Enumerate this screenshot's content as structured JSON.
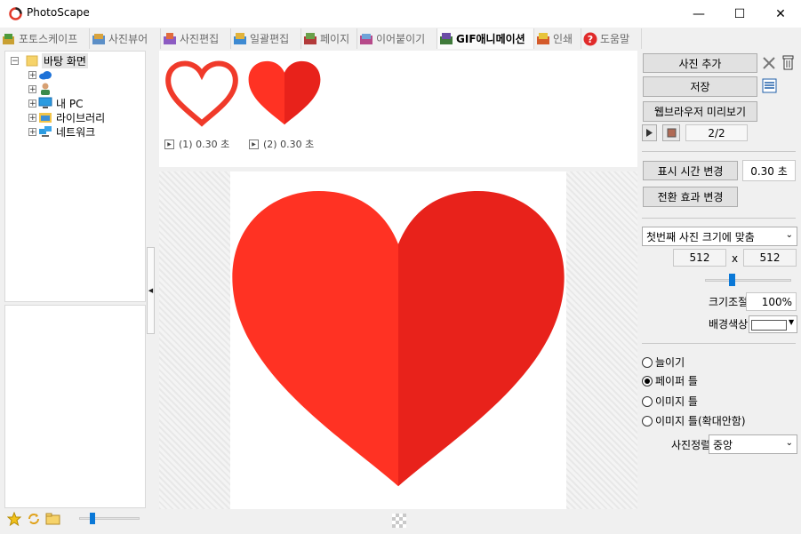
{
  "window": {
    "title": "PhotoScape",
    "minimize": "—",
    "maximize": "☐",
    "close": "✕"
  },
  "tabs": [
    {
      "label": "포토스케이프"
    },
    {
      "label": "사진뷰어"
    },
    {
      "label": "사진편집"
    },
    {
      "label": "일괄편집"
    },
    {
      "label": "페이지"
    },
    {
      "label": "이어붙이기"
    },
    {
      "label": "GIF애니메이션"
    },
    {
      "label": "인쇄"
    },
    {
      "label": "도움말"
    }
  ],
  "tree": {
    "root": "바탕 화면",
    "items": [
      {
        "label": ""
      },
      {
        "label": ""
      },
      {
        "label": "내 PC"
      },
      {
        "label": "라이브러리"
      },
      {
        "label": "네트워크"
      }
    ]
  },
  "frames": [
    {
      "caption": "(1) 0.30 초"
    },
    {
      "caption": "(2) 0.30 초"
    }
  ],
  "colors": {
    "heart_left": "#ff3223",
    "heart_right": "#e8221b",
    "outline": "#f03a2a"
  },
  "controls": {
    "add_photo": "사진 추가",
    "save": "저장",
    "preview_browser": "웹브라우저 미리보기",
    "frame_counter": "2/2",
    "display_time_button": "표시 시간 변경",
    "display_time_value": "0.30 초",
    "transition_button": "전환 효과 변경",
    "size_mode": "첫번째 사진 크기에 맞춤",
    "width": "512",
    "x_label": "x",
    "height": "512",
    "zoom_label": "크기조절",
    "zoom_value": "100%",
    "bg_color_label": "배경색상",
    "radio_options": [
      {
        "label": "늘이기",
        "checked": false
      },
      {
        "label": "페이퍼 틀",
        "checked": true
      },
      {
        "label": "이미지 틀",
        "checked": false
      },
      {
        "label": "이미지 틀(확대안함)",
        "checked": false
      }
    ],
    "align_label": "사진정렬",
    "align_value": "중앙"
  }
}
